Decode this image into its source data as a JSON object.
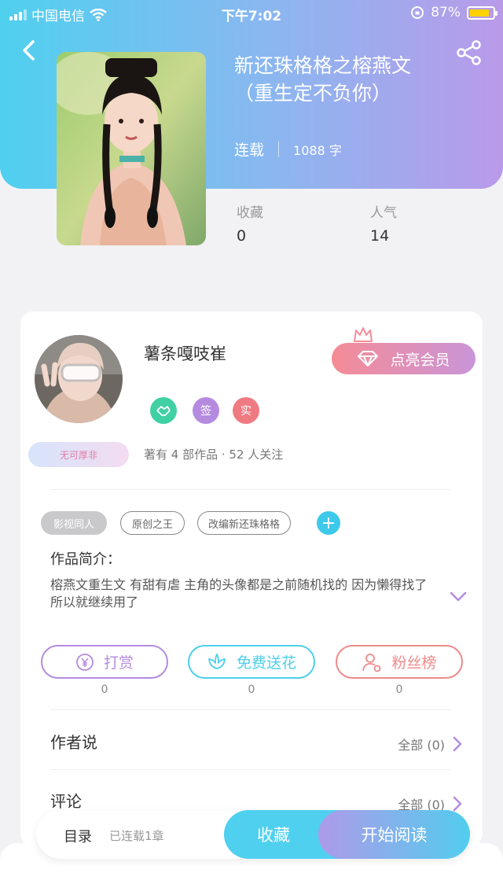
{
  "status_bar": {
    "carrier": "中国电信",
    "time": "下午7:02",
    "battery": "87%",
    "battery_level": 0.87
  },
  "header": {
    "back_icon": "chevron-left-icon",
    "share_icon": "share-icon"
  },
  "book": {
    "title_line1": "新还珠格格之榕燕文",
    "title_line2": "（重生定不负你）",
    "status": "连载",
    "word_count": "1088 字",
    "stats": [
      {
        "label": "收藏",
        "value": "0"
      },
      {
        "label": "人气",
        "value": "14"
      }
    ]
  },
  "author": {
    "name": "薯条嘎吱崔",
    "badges": [
      "签",
      "实"
    ],
    "fan_title": "无可厚非",
    "summary": "著有 4 部作品 · 52 人关注",
    "member_button": "点亮会员"
  },
  "tags": [
    "影视同人",
    "原创之王",
    "改编新还珠格格"
  ],
  "intro": {
    "heading": "作品简介：",
    "text": "榕燕文重生文 有甜有虐 主角的头像都是之前随机找的 因为懒得找了 所以就继续用了"
  },
  "actions": [
    {
      "label": "打赏",
      "count": "0",
      "icon": "yen-icon",
      "color": "#b58be0"
    },
    {
      "label": "免费送花",
      "count": "0",
      "icon": "flower-icon",
      "color": "#4ccfea"
    },
    {
      "label": "粉丝榜",
      "count": "0",
      "icon": "user-rank-icon",
      "color": "#ee8a8a"
    }
  ],
  "sections": [
    {
      "title": "作者说",
      "all": "全部 (0)"
    },
    {
      "title": "评论",
      "all": "全部 (0)"
    }
  ],
  "bottom_bar": {
    "toc": "目录",
    "chapters": "已连载1章",
    "collect": "收藏",
    "read": "开始阅读"
  },
  "colors": {
    "accent_blue": "#4fd0ef",
    "accent_purple": "#b99ae9",
    "member_pink": "#f58b96"
  }
}
